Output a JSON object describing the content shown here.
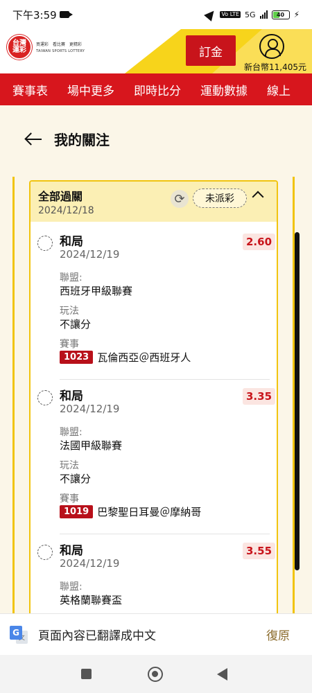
{
  "status_bar": {
    "time": "下午3:59",
    "network": "5G",
    "volte": "Vo LTE",
    "battery": "40"
  },
  "header": {
    "logo_line1": "台灣",
    "logo_line2": "運彩",
    "logo_tagline": "買運彩　看比賽　更精彩",
    "logo_en": "TAIWAN SPORTS LOTTERY",
    "deposit_label": "訂金",
    "balance": "新台幣11,405元"
  },
  "nav": {
    "items": [
      "賽事表",
      "場中更多",
      "即時比分",
      "運動數據",
      "線上"
    ]
  },
  "page": {
    "title": "我的關注"
  },
  "ticket": {
    "title": "全部過關",
    "date": "2024/12/18",
    "status": "未派彩"
  },
  "labels": {
    "league": "聯盟:",
    "play": "玩法",
    "match": "賽事"
  },
  "bets": [
    {
      "selection": "和局",
      "date": "2024/12/19",
      "odds": "2.60",
      "league": "西班牙甲級聯賽",
      "play": "不讓分",
      "match_id": "1023",
      "match": "瓦倫西亞＠西班牙人"
    },
    {
      "selection": "和局",
      "date": "2024/12/19",
      "odds": "3.35",
      "league": "法國甲級聯賽",
      "play": "不讓分",
      "match_id": "1019",
      "match": "巴黎聖日耳曼＠摩納哥"
    },
    {
      "selection": "和局",
      "date": "2024/12/19",
      "odds": "3.55",
      "league": "英格蘭聯賽盃"
    }
  ],
  "translate_bar": {
    "text": "頁面內容已翻譯成中文",
    "restore": "復原"
  },
  "colors": {
    "brand_red": "#d7161d",
    "accent_yellow": "#f1c40f",
    "odds_red": "#c8141b"
  }
}
